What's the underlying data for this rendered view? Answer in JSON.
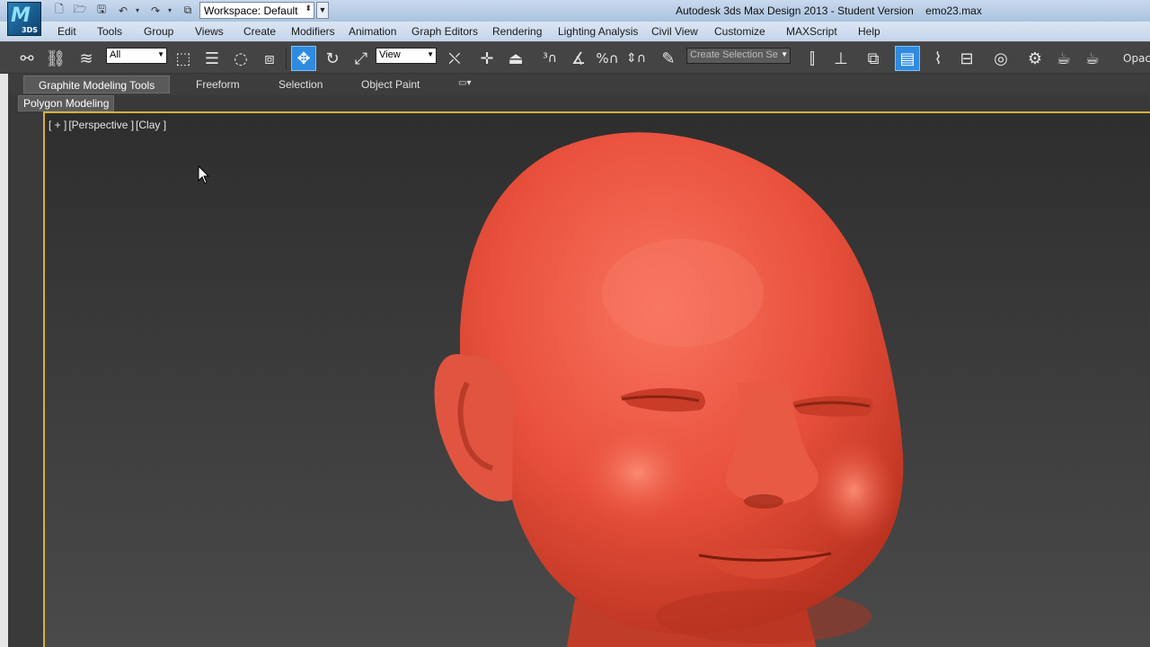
{
  "window": {
    "title": "Autodesk 3ds Max Design 2013 - Student Version    emo23.max",
    "logo_sub": "3DS",
    "workspace_label": "Workspace: Default"
  },
  "quick_access": [
    "new-file-icon",
    "open-folder-icon",
    "save-icon",
    "undo-icon",
    "redo-icon",
    "project-folder-icon"
  ],
  "menu": [
    "Edit",
    "Tools",
    "Group",
    "Views",
    "Create",
    "Modifiers",
    "Animation",
    "Graph Editors",
    "Rendering",
    "Lighting Analysis",
    "Civil View",
    "Customize",
    "MAXScript",
    "Help"
  ],
  "toolbar": {
    "selection_filter": "All",
    "ref_coord": "View",
    "named_selection": "Create Selection Se",
    "overflow_label": "Opac",
    "active_tools": [
      "select-move-icon",
      "graphite-toggle-icon"
    ]
  },
  "ribbon": {
    "tabs": [
      "Graphite Modeling Tools",
      "Freeform",
      "Selection",
      "Object Paint"
    ],
    "active_tab": "Graphite Modeling Tools",
    "panel": "Polygon Modeling"
  },
  "viewport": {
    "labels": [
      "[ + ]",
      "[Perspective ]",
      "[Clay ]"
    ],
    "model_name": "head",
    "clay_color": "#e8503c",
    "border_color": "#d4b23c"
  }
}
